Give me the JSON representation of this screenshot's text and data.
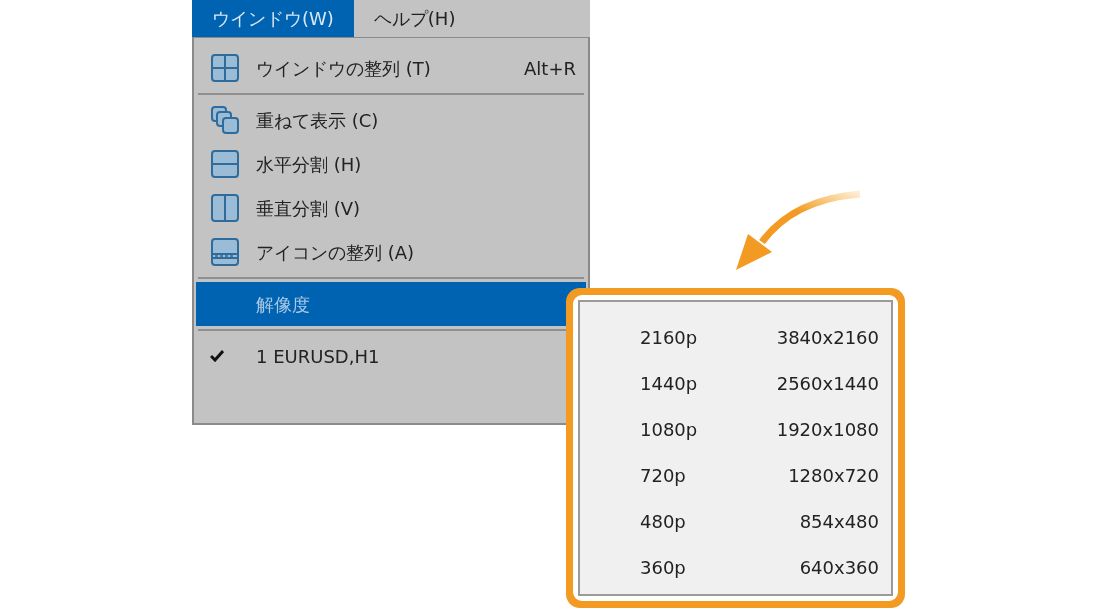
{
  "menubar": [
    {
      "label": "ウインドウ(W)",
      "selected": true
    },
    {
      "label": "ヘルプ(H)",
      "selected": false
    }
  ],
  "menu": [
    {
      "kind": "item",
      "label": "ウインドウの整列 (T)",
      "shortcut": "Alt+R"
    },
    {
      "kind": "separator"
    },
    {
      "kind": "item",
      "label": "重ねて表示 (C)"
    },
    {
      "kind": "item",
      "label": "水平分割 (H)"
    },
    {
      "kind": "item",
      "label": "垂直分割 (V)"
    },
    {
      "kind": "item",
      "label": "アイコンの整列 (A)"
    },
    {
      "kind": "separator"
    },
    {
      "kind": "item",
      "label": "解像度",
      "selected": true
    },
    {
      "kind": "separator"
    },
    {
      "kind": "item",
      "label": "1 EURUSD,H1",
      "checked": true
    }
  ],
  "submenu": [
    {
      "name": "2160p",
      "size": "3840x2160"
    },
    {
      "name": "1440p",
      "size": "2560x1440"
    },
    {
      "name": "1080p",
      "size": "1920x1080"
    },
    {
      "name": "720p",
      "size": "1280x720"
    },
    {
      "name": "480p",
      "size": "854x480"
    },
    {
      "name": "360p",
      "size": "640x360"
    }
  ]
}
